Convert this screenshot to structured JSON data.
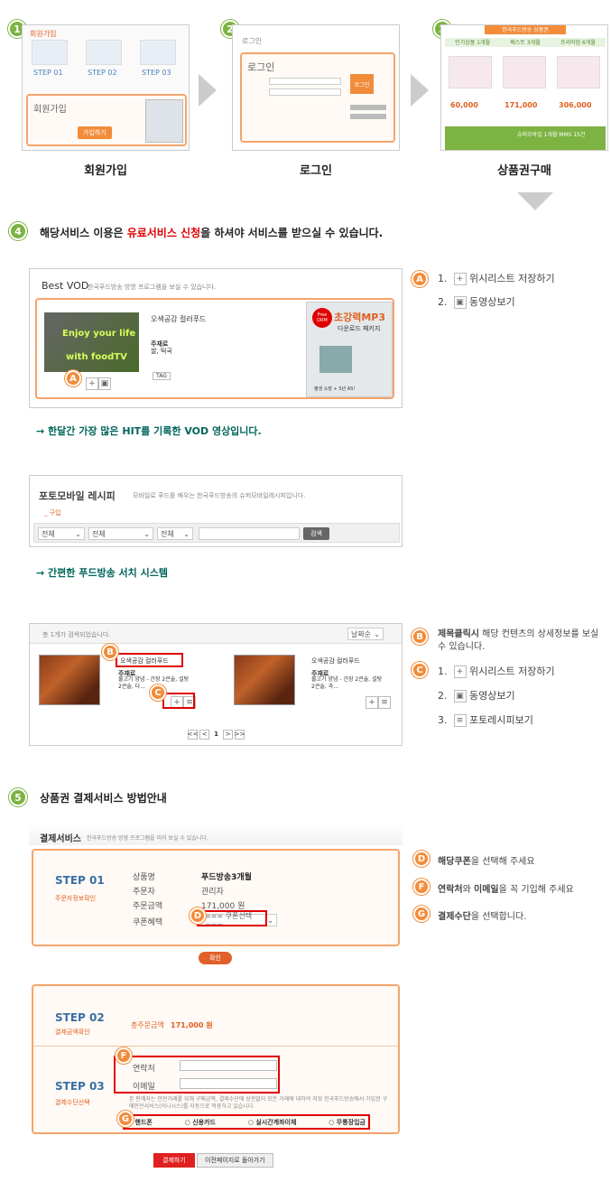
{
  "steps": {
    "s1_badge": "1",
    "s2_badge": "2",
    "s3_badge": "3",
    "s1_caption": "회원가입",
    "s2_caption": "로그인",
    "s3_caption": "상품권구매",
    "s1_inner_title": "회원가입",
    "s1_step_labels": [
      "STEP 01",
      "STEP 02",
      "STEP 03"
    ],
    "s1_button": "가입하기",
    "s2_inner_title": "로그인",
    "s2_button": "로그인",
    "s3_header": "한국푸드방송 상품권",
    "s3_tabs": [
      "인기상품 1개월",
      "베스트 3개월",
      "프리미엄 6개월"
    ],
    "s3_prices": [
      "60,000",
      "171,000",
      "306,000"
    ],
    "s3_mms": "슈퍼모바일 1개월 MMS 15건"
  },
  "section4": {
    "badge": "4",
    "text_pre": "해당서비스 이용은 ",
    "text_highlight": "유료서비스 신청",
    "text_post": "을 하셔야  서비스를 받으실 수 있습니다."
  },
  "vod": {
    "title": "Best VOD",
    "subtitle": "한국푸드방송 방영 프로그램을 보실 수 있습니다.",
    "video_line1": "Enjoy your life",
    "video_line2": "with foodTV",
    "item_title": "오색공감 컬러푸드",
    "ingredient_label": "주재료",
    "ingredient_value": "쌀, 떡국",
    "tag": "TAG",
    "ad_badge": "Free DRM",
    "ad_title": "초강력MP3",
    "ad_sub": "다운로드 패키지",
    "ad_foot": "평생 소장 + 5년 AS!",
    "marker": "A",
    "note": "→  한달간 가장 많은 HIT를 기록한 VOD 영상입니다."
  },
  "legend_a": {
    "marker": "A",
    "items": [
      {
        "num": "1.",
        "icon": "+",
        "label": "위시리스트 저장하기"
      },
      {
        "num": "2.",
        "icon": "▣",
        "label": "동영상보기"
      }
    ]
  },
  "mobile": {
    "title": "포토모바일 레시피",
    "subtitle": "모바일로 푸드를 배우는 한국푸드방송의 슈퍼모바일레시피입니다.",
    "filter_label": "_ 구입",
    "selects": [
      "전체",
      "전체",
      "전체"
    ],
    "search_button": "검색",
    "note": "→  간편한 푸드방송 서치 시스템"
  },
  "results": {
    "count_text": "총 1개가 검색되었습니다.",
    "sort": "날짜순",
    "items": [
      {
        "title": "오색공감 컬러푸드",
        "ing_label": "주재료",
        "ing_value": "불고기 양념 - 간장 2큰술, 설탕 2큰술, 다..."
      },
      {
        "title": "오색공감 컬러푸드",
        "ing_label": "주재료",
        "ing_value": "불고기 양념 - 간장 2큰술, 설탕 2큰술, 과..."
      }
    ],
    "marker_b": "B",
    "marker_c": "C",
    "pager": [
      "<<",
      "<",
      "1",
      ">",
      ">>"
    ]
  },
  "legend_b": {
    "marker": "B",
    "bold": "제목클릭시",
    "text": " 해당 컨텐츠의 상세정보를 보실 수 있습니다."
  },
  "legend_c": {
    "marker": "C",
    "items": [
      {
        "num": "1.",
        "icon": "+",
        "label": "위시리스트 저장하기"
      },
      {
        "num": "2.",
        "icon": "▣",
        "label": "동영상보기"
      },
      {
        "num": "3.",
        "icon": "≡",
        "label": "포토레시피보기"
      }
    ]
  },
  "section5": {
    "badge": "5",
    "title": "상품권 결제서비스 방법안내"
  },
  "payment": {
    "title": "결제서비스",
    "subtitle": "한국푸드방송 방영 프로그램을 미리 보실 수 있습니다.",
    "step1_no": "STEP 01",
    "step1_label": "주문자정보확인",
    "rows": [
      {
        "label": "상품명",
        "value": "푸드방송3개월"
      },
      {
        "label": "주문자",
        "value": "관리자"
      },
      {
        "label": "주문금액",
        "value": "171,000 원"
      },
      {
        "label": "쿠폰혜택",
        "value": "=== 쿠폰선택 ==="
      }
    ],
    "marker_d": "D",
    "confirm_button": "확인",
    "step2_no": "STEP 02",
    "step2_label": "결제금액확인",
    "total_label": "총주문금액",
    "total_value": "171,000 원",
    "step3_no": "STEP 03",
    "step3_label": "결제수단선택",
    "contact_label": "연락처",
    "email_label": "이메일",
    "marker_f": "F",
    "notice": "본 판매자는 안전거래를 위해 구매금액, 결제수단에 상관없이 모든 거래에 대하여 저희 한국푸드방송에서 가입한 구매안전서비스(이니시스)를 자동으로 적용하고 있습니다.",
    "methods": [
      "핸드폰",
      "신용카드",
      "실시간계좌이체",
      "무통장입금"
    ],
    "marker_g": "G",
    "pay_button": "결제하기",
    "back_button": "이전페이지로 돌아가기"
  },
  "legend_dfg": [
    {
      "marker": "D",
      "bold": "해당쿠폰",
      "text": "을 선택해 주세요"
    },
    {
      "marker": "F",
      "bold": "연락처",
      "mid": "와 ",
      "bold2": "이메일",
      "text": "을 꼭 기입해 주세요"
    },
    {
      "marker": "G",
      "bold": "결제수단",
      "text": "을 선택합니다."
    }
  ],
  "colors": {
    "accent_orange": "#f28c3a",
    "highlight_red": "#e00000",
    "badge_green": "#7cb342",
    "note_teal": "#00665a"
  }
}
